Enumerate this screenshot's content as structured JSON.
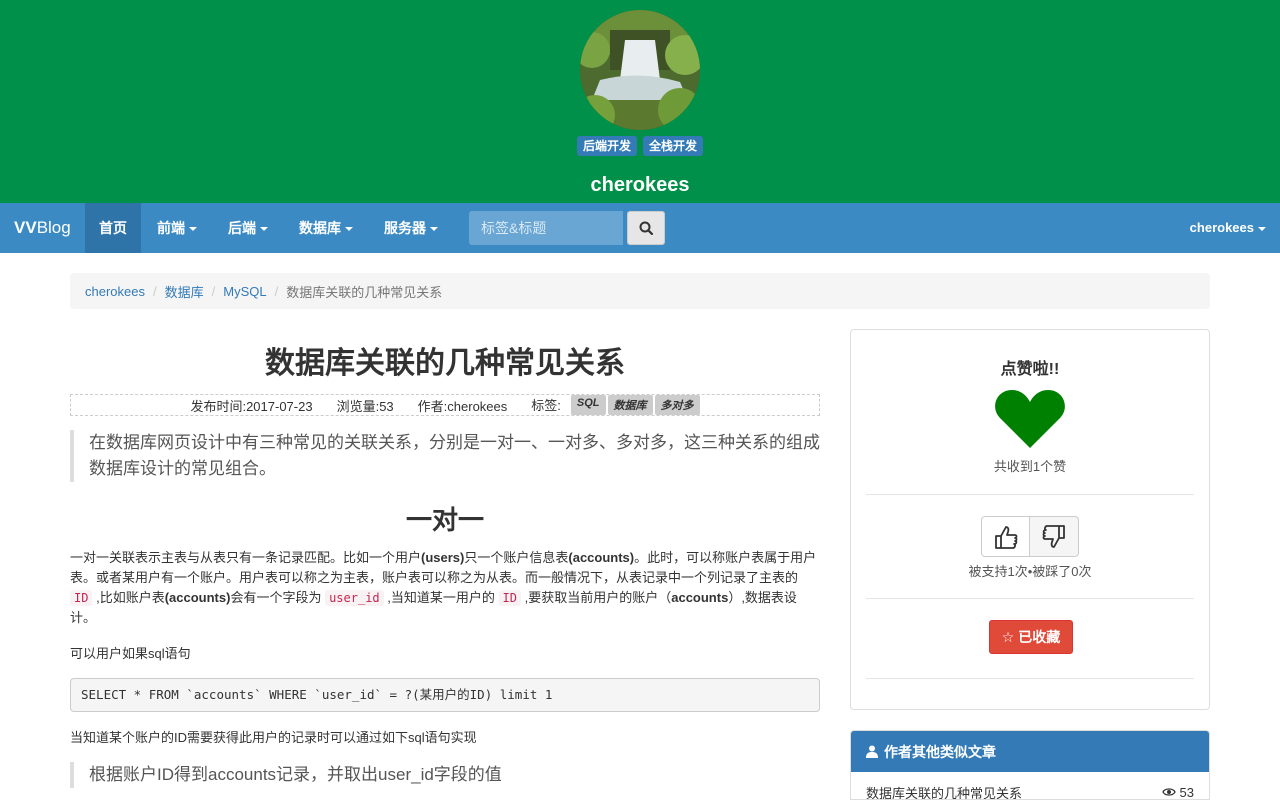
{
  "header": {
    "tags": [
      "后端开发",
      "全栈开发"
    ],
    "username": "cherokees"
  },
  "navbar": {
    "brand_bold": "VV",
    "brand_rest": "Blog",
    "items": [
      {
        "label": "首页",
        "active": true
      },
      {
        "label": "前端",
        "dropdown": true
      },
      {
        "label": "后端",
        "dropdown": true
      },
      {
        "label": "数据库",
        "dropdown": true
      },
      {
        "label": "服务器",
        "dropdown": true
      }
    ],
    "search_placeholder": "标签&标题",
    "user": "cherokees"
  },
  "breadcrumb": [
    "cherokees",
    "数据库",
    "MySQL",
    "数据库关联的几种常见关系"
  ],
  "article": {
    "title": "数据库关联的几种常见关系",
    "meta": {
      "published": "发布时间:2017-07-23",
      "views": "浏览量:53",
      "author": "作者:cherokees",
      "tags_label": "标签:",
      "tags": [
        "SQL",
        "数据库",
        "多对多"
      ]
    },
    "intro": "在数据库网页设计中有三种常见的关联关系，分别是一对一、一对多、多对多，这三种关系的组成数据库设计的常见组合。",
    "section_title": "一对一",
    "para1_a": "一对一关联表示主表与从表只有一条记录匹配。比如一个用户",
    "para1_b": "(users)",
    "para1_c": "只一个账户信息表",
    "para1_d": "(accounts)",
    "para1_e": "。此时，可以称账户表属于用户表。或者某用户有一个账户。用户表可以称之为主表，账户表可以称之为从表。而一般情况下，从表记录中一个列记录了主表的",
    "code_id": "ID",
    "para1_f": ",比如账户表",
    "para1_g": "(accounts)",
    "para1_h": "会有一个字段为",
    "code_user_id": "user_id",
    "para1_i": ",当知道某一用户的",
    "para1_j": ",要获取当前用户的账户（",
    "para1_k": "accounts",
    "para1_l": "）,数据表设计。",
    "para2": "可以用户如果sql语句",
    "sql": "SELECT * FROM `accounts` WHERE `user_id` = ?(某用户的ID) limit 1",
    "para3": "当知道某个账户的ID需要获得此用户的记录时可以通过如下sql语句实现",
    "quote2": "根据账户ID得到accounts记录，并取出user_id字段的值"
  },
  "sidebar": {
    "like_title": "点赞啦!!",
    "like_count": "共收到1个赞",
    "vote_stats": "被支持1次•被踩了0次",
    "favorite": "☆ 已收藏",
    "accent": "#008000"
  },
  "similar": {
    "heading": "作者其他类似文章",
    "items": [
      {
        "title": "数据库关联的几种常见关系",
        "views": "53"
      }
    ]
  }
}
